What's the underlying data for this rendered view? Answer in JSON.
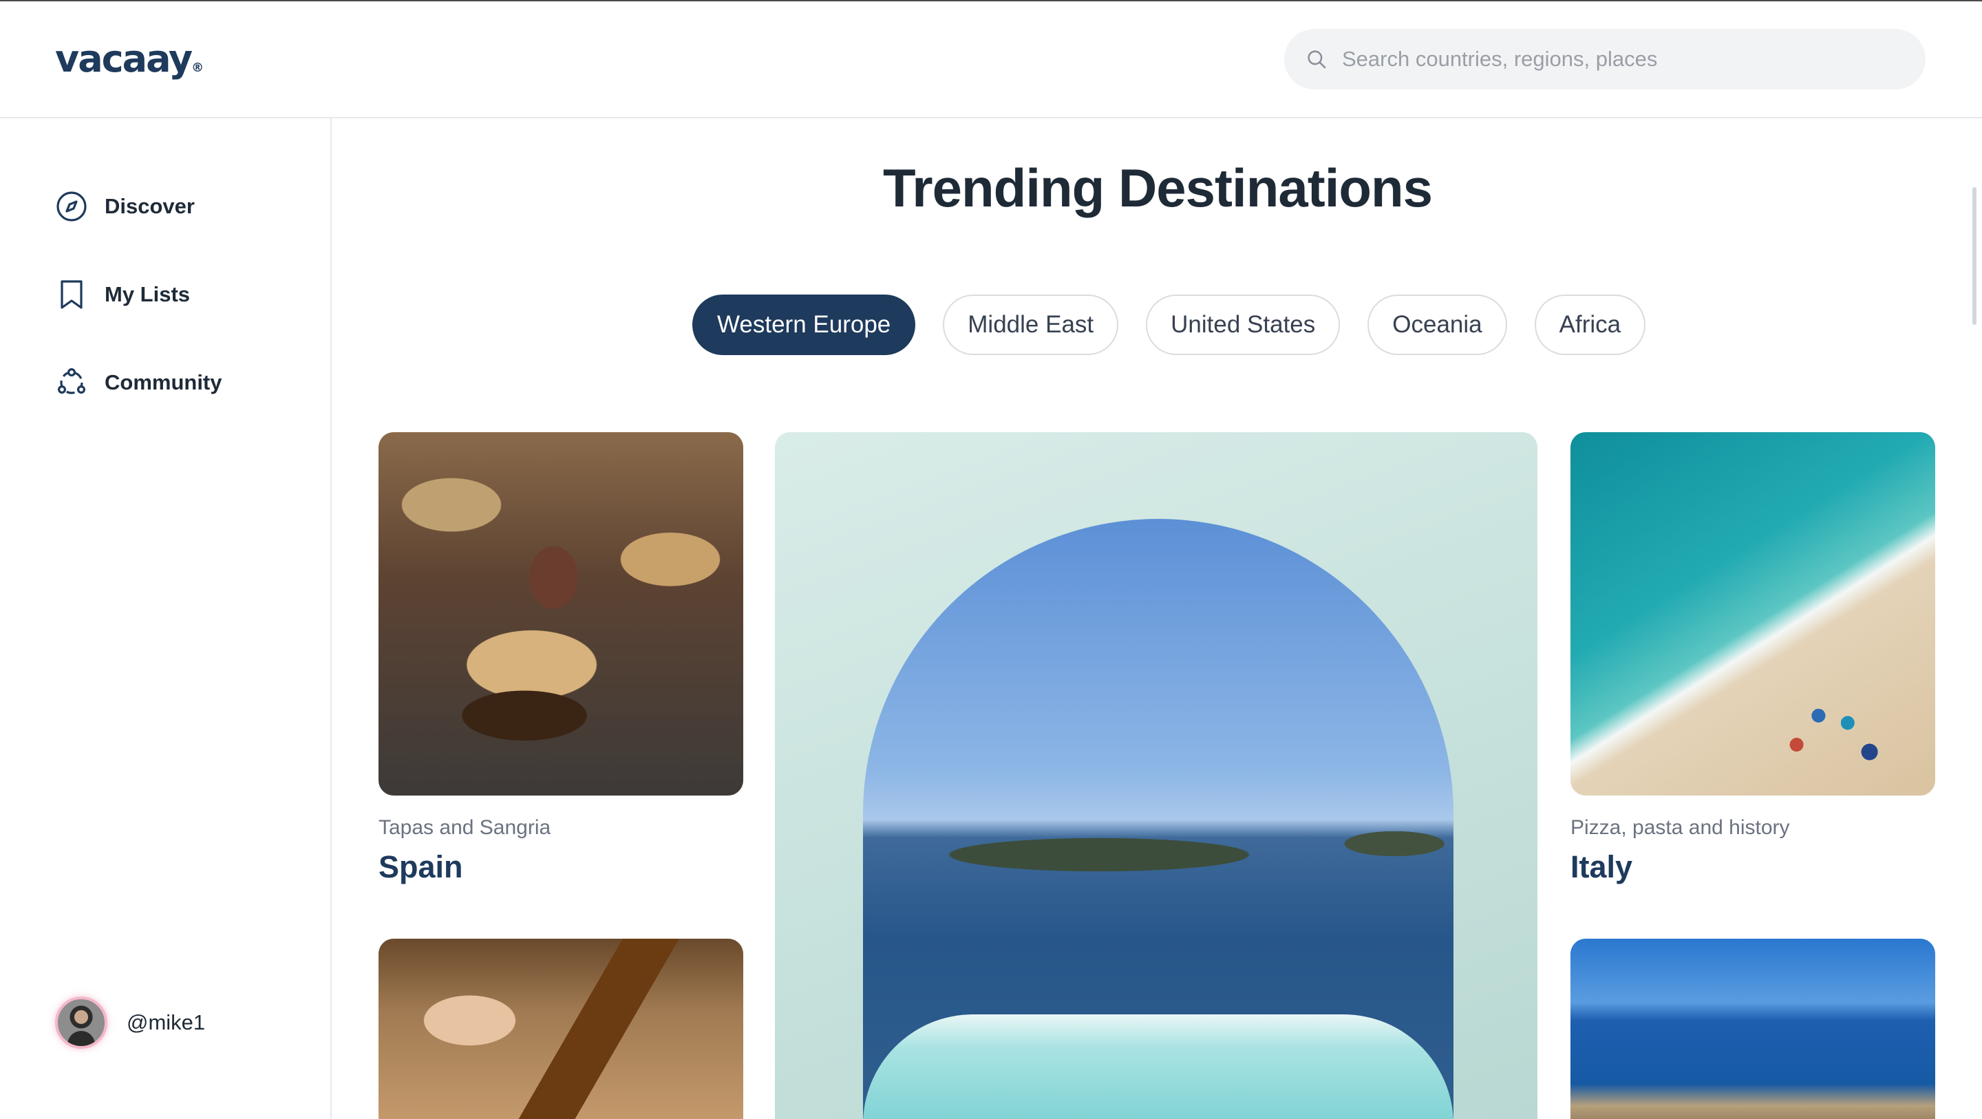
{
  "brand": {
    "logo_text": "vacaay",
    "logo_mark": "®"
  },
  "search": {
    "placeholder": "Search countries, regions, places"
  },
  "sidebar": {
    "items": [
      {
        "label": "Discover",
        "icon": "compass-icon"
      },
      {
        "label": "My Lists",
        "icon": "bookmark-icon"
      },
      {
        "label": "Community",
        "icon": "community-icon"
      }
    ],
    "user": {
      "handle": "@mike1"
    }
  },
  "main": {
    "title": "Trending Destinations",
    "tabs": [
      {
        "label": "Western Europe",
        "active": true
      },
      {
        "label": "Middle East",
        "active": false
      },
      {
        "label": "United States",
        "active": false
      },
      {
        "label": "Oceania",
        "active": false
      },
      {
        "label": "Africa",
        "active": false
      }
    ],
    "cards": [
      {
        "subtitle": "Tapas and Sangria",
        "title": "Spain"
      },
      {
        "subtitle": "Pizza, pasta and history",
        "title": "Italy"
      }
    ]
  },
  "colors": {
    "brand": "#1e3a5c",
    "active_tab_bg": "#1e3a5c",
    "text": "#1f2a37",
    "muted": "#6b7280"
  }
}
